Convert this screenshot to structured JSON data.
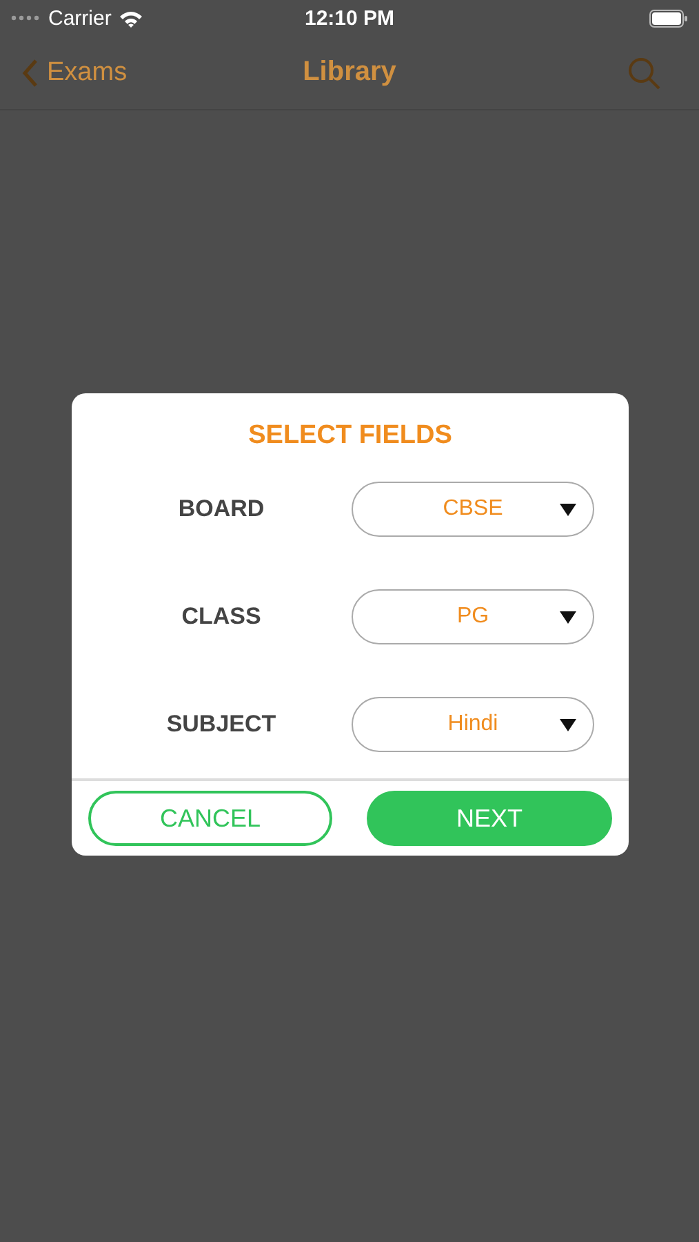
{
  "status_bar": {
    "carrier": "Carrier",
    "time": "12:10 PM"
  },
  "nav_bar": {
    "back": "Exams",
    "title": "Library"
  },
  "dialog": {
    "title": "SELECT FIELDS",
    "fields": [
      {
        "label": "BOARD",
        "value": "CBSE"
      },
      {
        "label": "CLASS",
        "value": "PG"
      },
      {
        "label": "SUBJECT",
        "value": "Hindi"
      }
    ],
    "buttons": [
      {
        "label": "CANCEL",
        "kind": "outline"
      },
      {
        "label": "NEXT",
        "kind": "filled"
      }
    ]
  }
}
